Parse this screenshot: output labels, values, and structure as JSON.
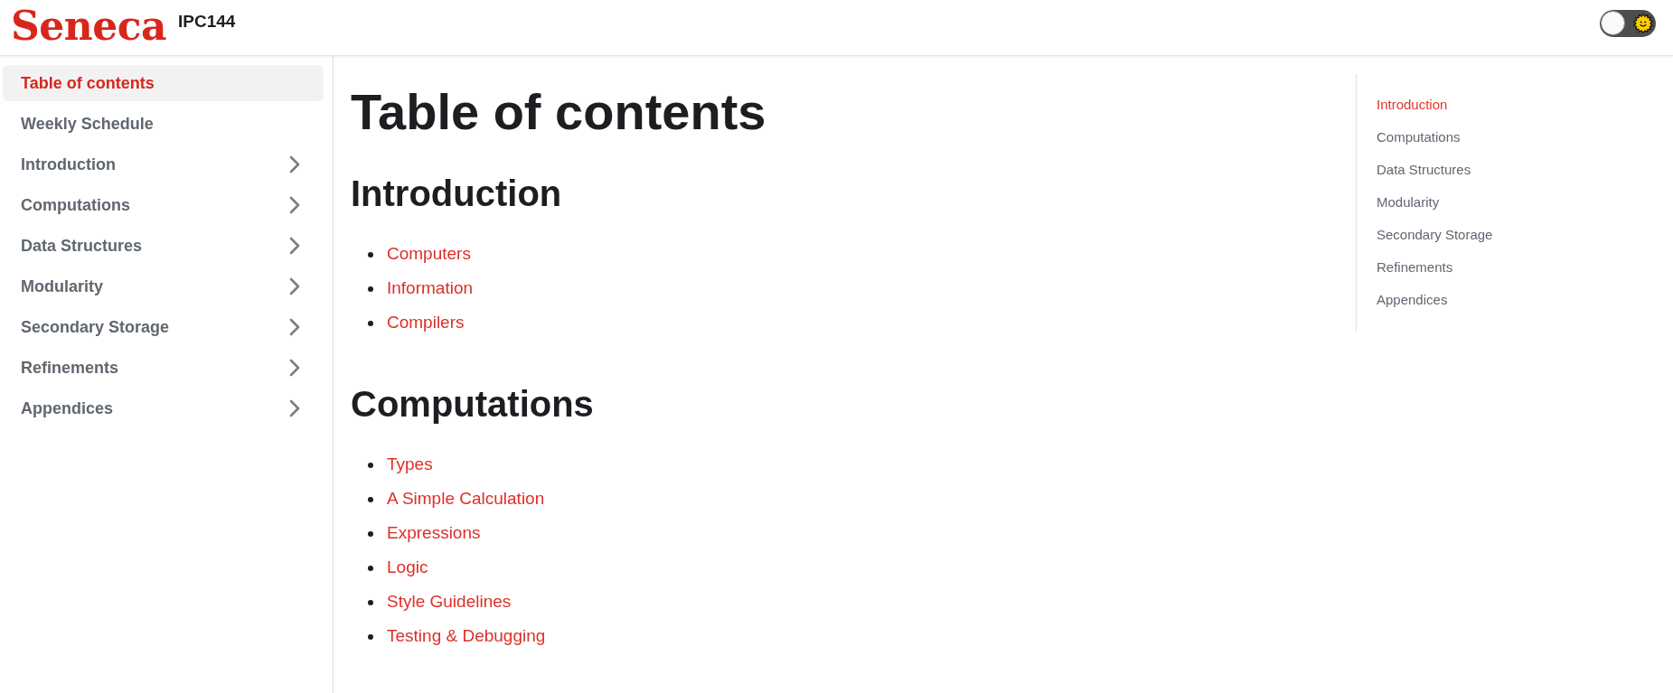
{
  "header": {
    "logo": "Seneca",
    "course": "IPC144",
    "theme_toggle": {
      "on": false
    }
  },
  "sidebar": {
    "items": [
      {
        "label": "Table of contents",
        "selected": true,
        "kind": "link"
      },
      {
        "label": "Weekly Schedule",
        "selected": false,
        "kind": "link"
      },
      {
        "label": "Introduction",
        "selected": false,
        "kind": "category",
        "expanded": false
      },
      {
        "label": "Computations",
        "selected": false,
        "kind": "category",
        "expanded": false
      },
      {
        "label": "Data Structures",
        "selected": false,
        "kind": "category",
        "expanded": false
      },
      {
        "label": "Modularity",
        "selected": false,
        "kind": "category",
        "expanded": false
      },
      {
        "label": "Secondary Storage",
        "selected": false,
        "kind": "category",
        "expanded": false
      },
      {
        "label": "Refinements",
        "selected": false,
        "kind": "category",
        "expanded": false
      },
      {
        "label": "Appendices",
        "selected": false,
        "kind": "category",
        "expanded": false
      }
    ]
  },
  "main": {
    "title": "Table of contents",
    "sections": [
      {
        "heading": "Introduction",
        "links": [
          "Computers",
          "Information",
          "Compilers"
        ]
      },
      {
        "heading": "Computations",
        "links": [
          "Types",
          "A Simple Calculation",
          "Expressions",
          "Logic",
          "Style Guidelines",
          "Testing & Debugging"
        ]
      }
    ]
  },
  "toc": {
    "items": [
      {
        "label": "Introduction",
        "selected": true
      },
      {
        "label": "Computations",
        "selected": false
      },
      {
        "label": "Data Structures",
        "selected": false
      },
      {
        "label": "Modularity",
        "selected": false
      },
      {
        "label": "Secondary Storage",
        "selected": false
      },
      {
        "label": "Refinements",
        "selected": false
      },
      {
        "label": "Appendices",
        "selected": false
      }
    ]
  }
}
